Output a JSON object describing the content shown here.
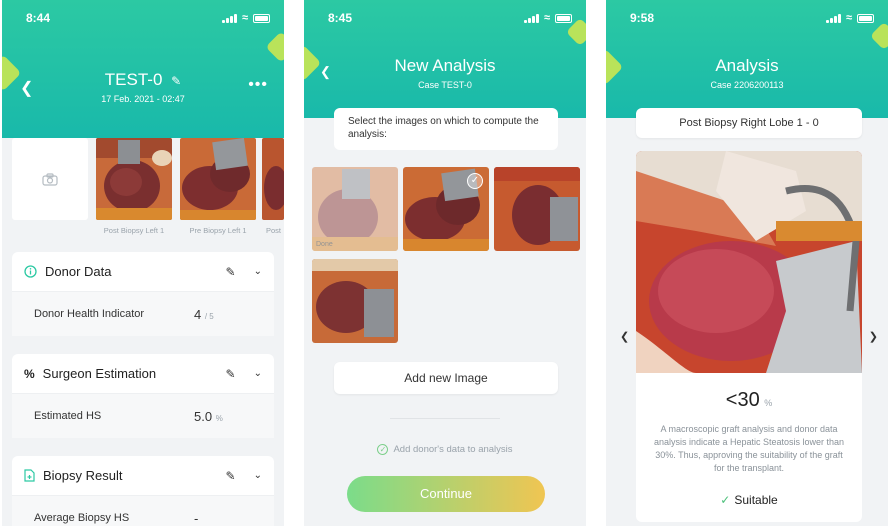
{
  "screen1": {
    "status_time": "8:44",
    "title": "TEST-0",
    "subtitle": "17 Feb. 2021 - 02:47",
    "thumbnails": [
      {
        "caption": "Post Biopsy Left 1"
      },
      {
        "caption": "Pre Biopsy Left 1"
      },
      {
        "caption": "Post"
      }
    ],
    "donor_card": {
      "title": "Donor Data",
      "row_label": "Donor Health Indicator",
      "row_value": "4",
      "row_unit": "/ 5"
    },
    "surgeon_card": {
      "title": "Surgeon Estimation",
      "row_label": "Estimated HS",
      "row_value": "5.0",
      "row_unit": "%"
    },
    "biopsy_card": {
      "title": "Biopsy Result",
      "row_label": "Average Biopsy HS",
      "row_value": "-"
    }
  },
  "screen2": {
    "status_time": "8:45",
    "title": "New Analysis",
    "subtitle": "Case TEST-0",
    "instruction": "Select the images on which to compute the analysis:",
    "done_label": "Done",
    "add_image": "Add new Image",
    "add_donor": "Add donor's data to analysis",
    "continue": "Continue"
  },
  "screen3": {
    "status_time": "9:58",
    "title": "Analysis",
    "subtitle": "Case 2206200113",
    "image_label": "Post Biopsy Right Lobe 1 - 0",
    "result_value": "<30",
    "result_unit": "%",
    "description": "A macroscopic graft analysis and donor data analysis indicate a Hepatic Steatosis lower than 30%. Thus, approving the suitability of the graft for the transplant.",
    "verdict": "Suitable"
  },
  "colors": {
    "header_green": "#22c4a6",
    "button_gradient_start": "#7bdc8a",
    "button_gradient_end": "#f0c552",
    "accent_check": "#4cc07a"
  }
}
